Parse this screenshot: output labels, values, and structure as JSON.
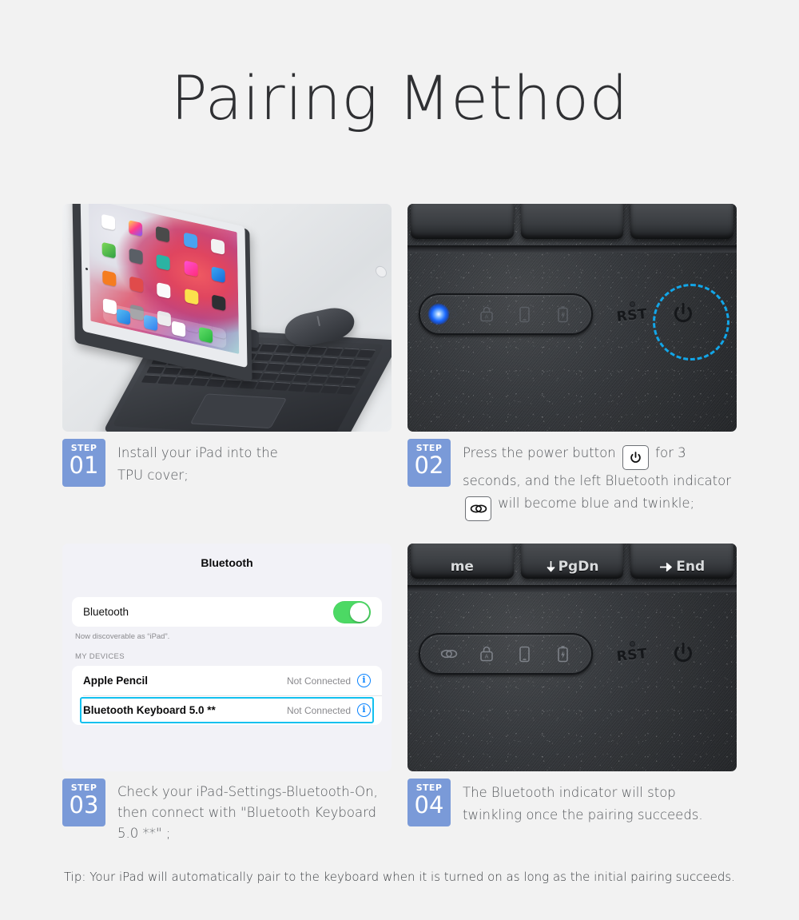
{
  "title": "Pairing Method",
  "steps": [
    {
      "badge_label": "STEP",
      "number": "01",
      "text": "Install your iPad into the TPU cover;",
      "photo": "ipad-in-keyboard-case-with-mouse"
    },
    {
      "badge_label": "STEP",
      "number": "02",
      "text_part1": "Press the power button",
      "icon1": "power-icon",
      "text_part2": "for 3 seconds, and the left Bluetooth indicator",
      "icon2": "bluetooth-link-icon",
      "text_part3": "will become blue and twinkle;",
      "photo": "keyboard-led-strip-bluetooth-lit"
    },
    {
      "badge_label": "STEP",
      "number": "03",
      "text": "Check your iPad-Settings-Bluetooth-On, then connect with \"Bluetooth Keyboard 5.0 **\" ;",
      "photo": "ipad-bluetooth-settings-screen"
    },
    {
      "badge_label": "STEP",
      "number": "04",
      "text": "The Bluetooth indicator will stop twinkling once the pairing succeeds.",
      "photo": "keyboard-led-strip-bluetooth-off"
    }
  ],
  "bluetooth_panel": {
    "header": "Bluetooth",
    "toggle_label": "Bluetooth",
    "toggle_state": "on",
    "discoverable_note": "Now discoverable as “iPad”.",
    "section_header": "MY DEVICES",
    "devices": [
      {
        "name": "Apple Pencil",
        "status": "Not Connected",
        "info": "i",
        "highlighted": false
      },
      {
        "name": "Bluetooth Keyboard 5.0 **",
        "status": "Not Connected",
        "info": "i",
        "highlighted": true
      }
    ]
  },
  "keyboard_photo": {
    "keycap_labels": [
      "me",
      "PgDn",
      "End"
    ],
    "reset_label": "RST",
    "indicators": [
      "bluetooth-link-icon",
      "caps-lock-icon",
      "device-icon",
      "battery-icon"
    ],
    "power_label": "power-icon"
  },
  "tip": "Tip:  Your iPad will automatically pair to the keyboard when it is turned on as long as the initial pairing succeeds.",
  "colors": {
    "background": "#f2f2f2",
    "badge_blue": "#7a9ad8",
    "title_gray": "#2f3033",
    "text_gray": "#55585c",
    "highlight_cyan": "#12c0ef",
    "dashed_ring_cyan": "#12a6e8",
    "toggle_green": "#4cd964",
    "info_blue": "#0a84ff",
    "led_blue": "#1766ff"
  }
}
